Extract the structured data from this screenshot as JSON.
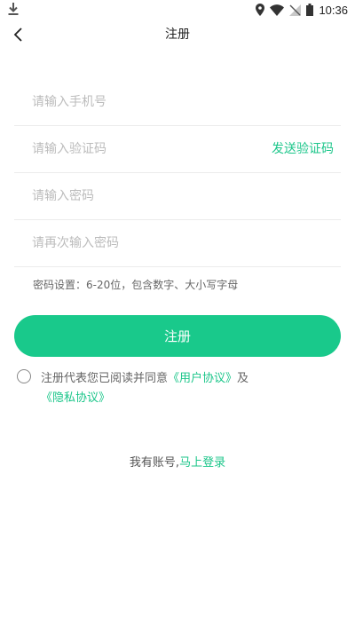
{
  "status_bar": {
    "time": "10:36"
  },
  "header": {
    "title": "注册"
  },
  "form": {
    "phone_placeholder": "请输入手机号",
    "code_placeholder": "请输入验证码",
    "send_code_label": "发送验证码",
    "password_placeholder": "请输入密码",
    "password_confirm_placeholder": "请再次输入密码",
    "password_hint": "密码设置：6-20位，包含数字、大小写字母",
    "register_label": "注册"
  },
  "agreement": {
    "prefix": "注册代表您已阅读并同意",
    "user_agreement": "《用户协议》",
    "conjunction": "及",
    "privacy_policy": "《隐私协议》"
  },
  "login": {
    "prompt": "我有账号,",
    "link": "马上登录"
  },
  "colors": {
    "accent": "#19c98b",
    "link": "#1cc68a"
  }
}
